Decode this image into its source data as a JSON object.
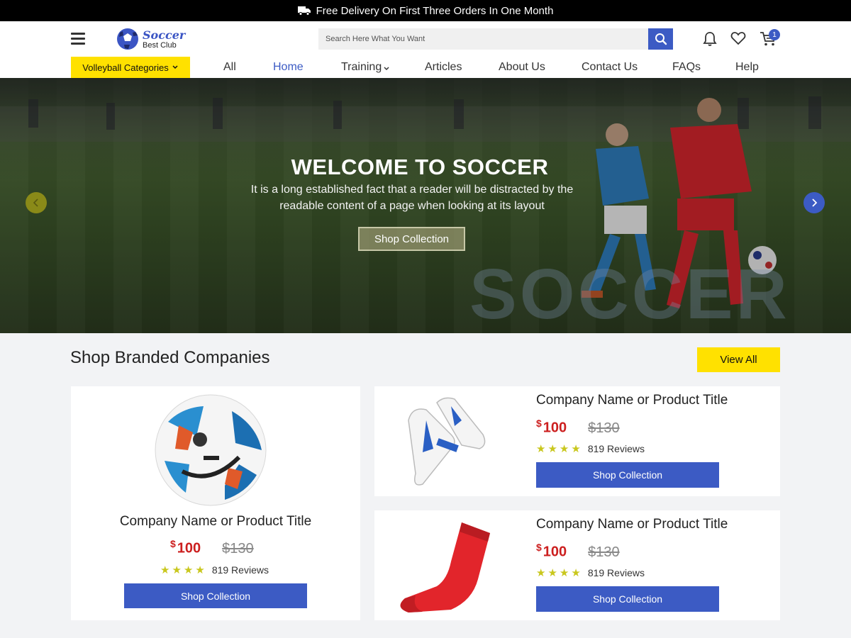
{
  "topbar": {
    "text": "Free Delivery On First Three Orders In One Month",
    "icon": "truck-icon"
  },
  "logo": {
    "title": "Soccer",
    "subtitle": "Best Club"
  },
  "search": {
    "placeholder": "Search Here What You Want"
  },
  "header_icons": [
    "bell-icon",
    "heart-icon",
    "cart-icon"
  ],
  "cart": {
    "count": "1"
  },
  "categories_button": "Volleyball Categories",
  "nav": [
    {
      "label": "All"
    },
    {
      "label": "Home",
      "active": true
    },
    {
      "label": "Training"
    },
    {
      "label": "Articles"
    },
    {
      "label": "About Us"
    },
    {
      "label": "Contact Us"
    },
    {
      "label": "FAQs"
    },
    {
      "label": "Help"
    }
  ],
  "hero": {
    "title": "WELCOME TO SOCCER",
    "text": "It is a long established fact that a reader will be distracted by the readable content of a page when looking at its layout",
    "button": "Shop Collection",
    "watermark": "SOCCER"
  },
  "section": {
    "title": "Shop Branded Companies",
    "view_all": "View All"
  },
  "products": [
    {
      "title": "Company Name or Product Title",
      "currency": "$",
      "price": "100",
      "old_price": "$130",
      "reviews": "819 Reviews",
      "stars": 4,
      "button": "Shop Collection",
      "image": "soccer-ball"
    },
    {
      "title": "Company Name or Product Title",
      "currency": "$",
      "price": "100",
      "old_price": "$130",
      "reviews": "819 Reviews",
      "stars": 4,
      "button": "Shop Collection",
      "image": "soccer-shoes"
    },
    {
      "title": "Company Name or Product Title",
      "currency": "$",
      "price": "100",
      "old_price": "$130",
      "reviews": "819 Reviews",
      "stars": 4,
      "button": "Shop Collection",
      "image": "red-sock"
    }
  ],
  "colors": {
    "accent": "#3c5bc4",
    "highlight": "#ffe100",
    "price": "#cc1f1f",
    "star": "#c9c71d"
  }
}
